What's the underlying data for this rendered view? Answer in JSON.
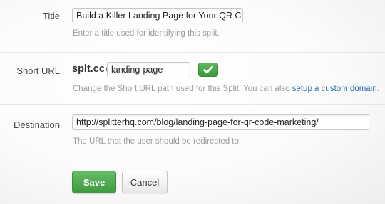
{
  "title": {
    "label": "Title",
    "value": "Build a Killer Landing Page for Your QR Code I",
    "help": "Enter a title used for identifying this split."
  },
  "short_url": {
    "label": "Short URL",
    "domain": "splt.cc",
    "slash": "/",
    "value": "landing-page",
    "help_text": "Change the Short URL path used for this Split. You can also ",
    "help_link": "setup a custom domain",
    "help_end": ".",
    "check_icon": "checkmark-icon"
  },
  "destination": {
    "label": "Destination",
    "value": "http://splitterhq.com/blog/landing-page-for-qr-code-marketing/",
    "help": "The URL that the user should be redirected to."
  },
  "actions": {
    "save_label": "Save",
    "cancel_label": "Cancel"
  },
  "colors": {
    "accent_green": "#4caf4c",
    "link_blue": "#2a6eb0"
  }
}
